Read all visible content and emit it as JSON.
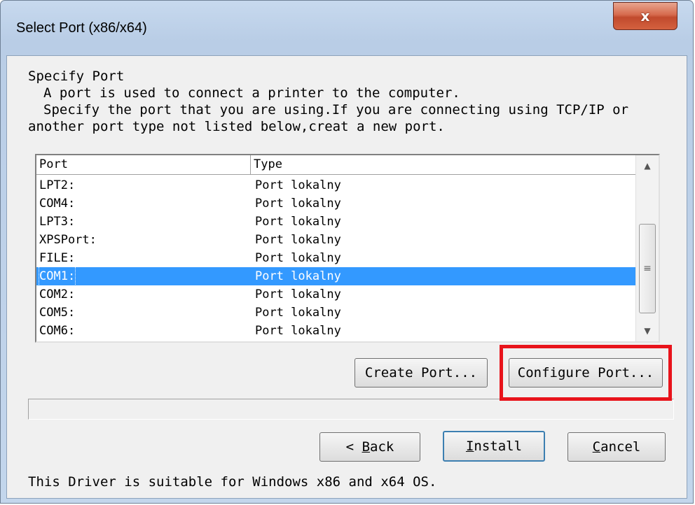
{
  "window": {
    "title": "Select Port (x86/x64)",
    "close_glyph": "x"
  },
  "header": {
    "heading": "Specify Port",
    "line1": "A port is used to connect a printer to the computer.",
    "line2": "Specify the port that you are using.If you are connecting using TCP/IP or",
    "line3": "another port type not listed below,creat a new port."
  },
  "port_list": {
    "columns": [
      "Port",
      "Type"
    ],
    "rows": [
      {
        "port": "LPT2:",
        "type": "Port lokalny",
        "selected": false
      },
      {
        "port": "COM4:",
        "type": "Port lokalny",
        "selected": false
      },
      {
        "port": "LPT3:",
        "type": "Port lokalny",
        "selected": false
      },
      {
        "port": "XPSPort:",
        "type": "Port lokalny",
        "selected": false
      },
      {
        "port": "FILE:",
        "type": "Port lokalny",
        "selected": false
      },
      {
        "port": "COM1:",
        "type": "Port lokalny",
        "selected": true
      },
      {
        "port": "COM2:",
        "type": "Port lokalny",
        "selected": false
      },
      {
        "port": "COM5:",
        "type": "Port lokalny",
        "selected": false
      },
      {
        "port": "COM6:",
        "type": "Port lokalny",
        "selected": false
      }
    ],
    "scroll_up_glyph": "▲",
    "scroll_down_glyph": "▼",
    "thumb_grip_glyph": "≡"
  },
  "buttons": {
    "create_port": "Create Port...",
    "configure_port": "Configure Port...",
    "back_glyph": "<",
    "back_mnemonic": "B",
    "back_rest": "ack",
    "install_mnemonic": "I",
    "install_rest": "nstall",
    "cancel_mnemonic": "C",
    "cancel_rest": "ancel"
  },
  "progress": {
    "value": 0
  },
  "footer": {
    "note": "This Driver is suitable for Windows x86 and x64 OS."
  },
  "colors": {
    "selection": "#3399ff",
    "highlight_box": "#e8131b",
    "close_button": "#c7503a"
  }
}
